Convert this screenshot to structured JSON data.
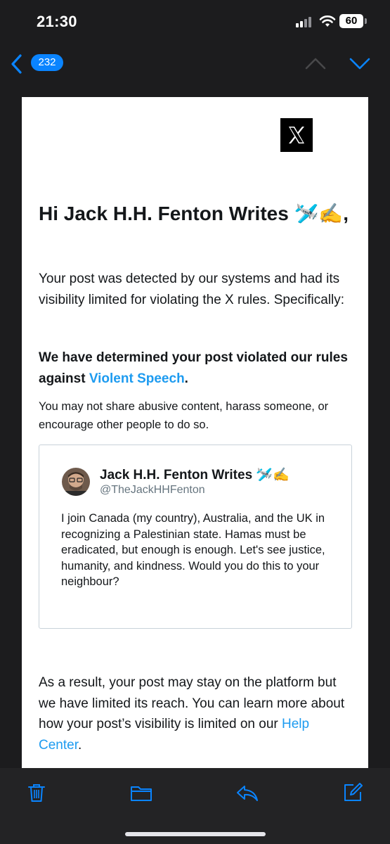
{
  "status_bar": {
    "time": "21:30",
    "battery_level": "60",
    "signal_icon": "cellular-signal-icon",
    "wifi_icon": "wifi-icon"
  },
  "nav": {
    "back_icon": "chevron-left-icon",
    "message_count": "232",
    "prev_icon": "chevron-up-icon",
    "next_icon": "chevron-down-icon",
    "accent_color": "#0a84ff"
  },
  "email": {
    "logo_letter": "X",
    "greeting": "Hi Jack H.H. Fenton Writes 🛩️✍️,",
    "intro": "Your post was detected by our systems and had its visibility limited for violating the X rules. Specifically:",
    "violation_prefix": "We have determined your post violated our rules against ",
    "violation_link": "Violent Speech",
    "violation_suffix": ".",
    "violation_detail": "You may not share abusive content, harass someone, or encourage other people to do so.",
    "tweet": {
      "author_name": "Jack H.H. Fenton Writes 🛩️✍️",
      "author_handle": "@TheJackHHFenton",
      "text": "I join Canada (my country), Australia, and the UK in recognizing a Palestinian state. Hamas must be eradicated, but enough is enough. Let's see justice, humanity, and kindness. Would you do this to your neighbour?"
    },
    "result_prefix": "As a result, your post may stay on the platform but we have limited its reach. You can learn more about how your post’s visibility is limited on our ",
    "result_link": "Help Center",
    "result_suffix": ".",
    "link_color": "#1d9bf0"
  },
  "toolbar": {
    "icons": [
      "trash-icon",
      "folder-icon",
      "reply-icon",
      "compose-icon"
    ]
  }
}
